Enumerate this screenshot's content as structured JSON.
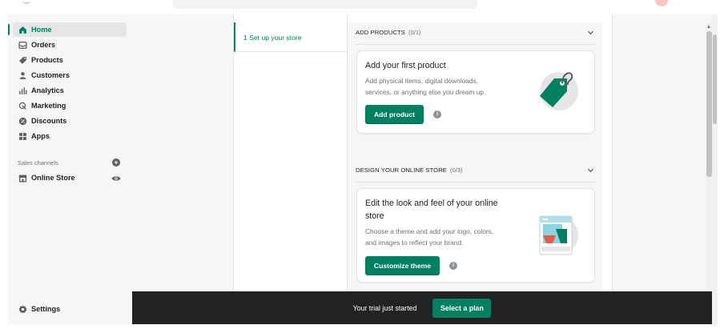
{
  "sidebar": {
    "items": [
      {
        "label": "Home",
        "icon": "home-icon",
        "active": true
      },
      {
        "label": "Orders",
        "icon": "orders-icon"
      },
      {
        "label": "Products",
        "icon": "tag-icon"
      },
      {
        "label": "Customers",
        "icon": "person-icon"
      },
      {
        "label": "Analytics",
        "icon": "bar-chart-icon"
      },
      {
        "label": "Marketing",
        "icon": "marketing-icon"
      },
      {
        "label": "Discounts",
        "icon": "discount-icon"
      },
      {
        "label": "Apps",
        "icon": "apps-icon"
      }
    ],
    "sales_channels_label": "Sales channels",
    "online_store_label": "Online Store",
    "settings_label": "Settings",
    "accent_color": "#008060"
  },
  "setup": {
    "step_label": "1 Set up your store",
    "sections": [
      {
        "title": "ADD PRODUCTS",
        "count": "(0/1)",
        "card_title": "Add your first product",
        "card_desc_1": "Add physical items, digital downloads,",
        "card_desc_2": "services, or anything else you dream up.",
        "button_label": "Add product"
      },
      {
        "title": "DESIGN YOUR ONLINE STORE",
        "count": "(0/3)",
        "card_title_1": "Edit the look and feel of your online",
        "card_title_2": "store",
        "card_desc_1": "Choose a theme and add your logo, colors,",
        "card_desc_2": "and images to reflect your brand.",
        "button_label": "Customize theme"
      }
    ]
  },
  "trial_bar": {
    "message": "Your trial just started",
    "button_label": "Select a plan"
  },
  "colors": {
    "primary": "#008060",
    "dark_bar": "#202223",
    "sidebar_bg": "#f6f6f7"
  }
}
